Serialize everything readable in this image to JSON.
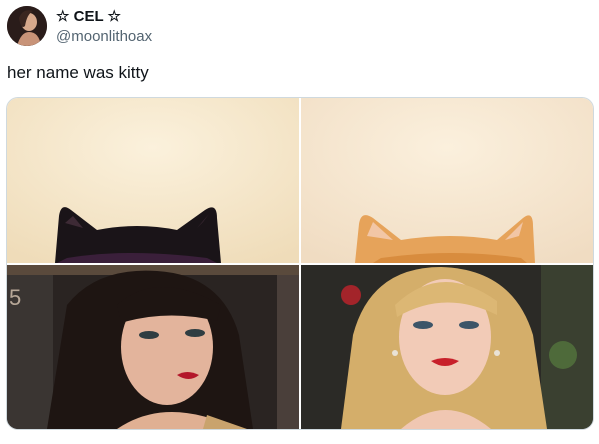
{
  "tweet": {
    "display_name": "☆ CEL ☆",
    "handle": "@moonlithoax",
    "text": "her name was kitty"
  },
  "media": {
    "panels": [
      {
        "id": "top-left",
        "depicts": "black-cat-ears"
      },
      {
        "id": "top-right",
        "depicts": "orange-cat-ears"
      },
      {
        "id": "bottom-left",
        "depicts": "dark-haired-woman"
      },
      {
        "id": "bottom-right",
        "depicts": "blonde-haired-woman"
      }
    ],
    "colors": {
      "cream_background": "#f5e8cf",
      "black_cat": "#1a1418",
      "orange_cat": "#e6a35a",
      "border": "#cfd9de"
    }
  }
}
